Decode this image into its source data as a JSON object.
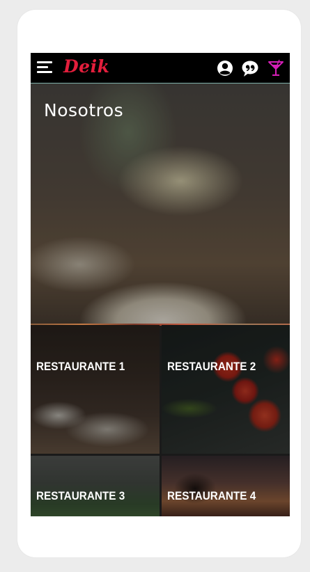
{
  "app": {
    "logo": "Deik",
    "accent_color": "#e41e3c",
    "icons": [
      "menu-icon",
      "user-icon",
      "quote-icon",
      "cocktail-icon"
    ]
  },
  "hero": {
    "title": "Nosotros"
  },
  "restaurants": [
    {
      "label": "RESTAURANTE 1"
    },
    {
      "label": "RESTAURANTE 2"
    },
    {
      "label": "RESTAURANTE 3"
    },
    {
      "label": "RESTAURANTE 4"
    }
  ]
}
